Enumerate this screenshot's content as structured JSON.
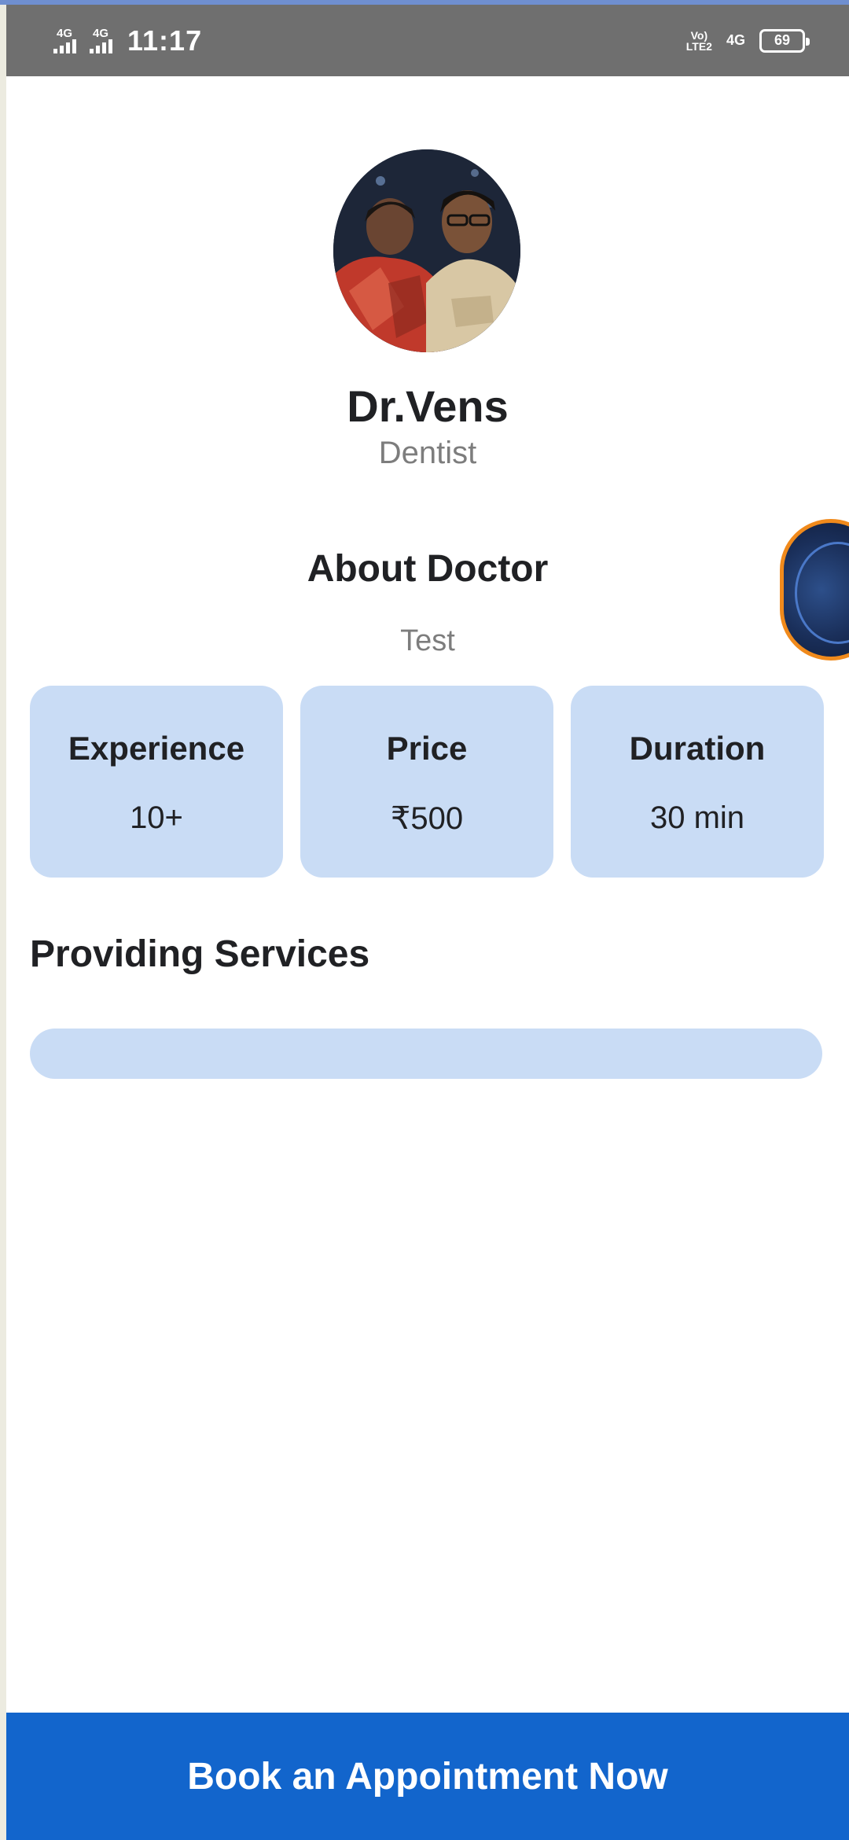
{
  "status_bar": {
    "sim1_label": "4G",
    "sim2_label": "4G",
    "time": "11:17",
    "volte_top": "Vo)",
    "volte_bottom": "LTE2",
    "network": "4G",
    "battery": "69"
  },
  "doctor": {
    "name": "Dr.Vens",
    "specialty": "Dentist"
  },
  "about": {
    "title": "About Doctor",
    "text": "Test"
  },
  "stats": [
    {
      "label": "Experience",
      "value": "10+"
    },
    {
      "label": "Price",
      "value": "₹500"
    },
    {
      "label": "Duration",
      "value": "30 min"
    }
  ],
  "services": {
    "title": "Providing Services"
  },
  "cta": {
    "label": "Book an Appointment Now"
  },
  "colors": {
    "accent": "#1265cc",
    "card_bg": "#c9dcf5",
    "status_bar": "#6f6f6f"
  }
}
